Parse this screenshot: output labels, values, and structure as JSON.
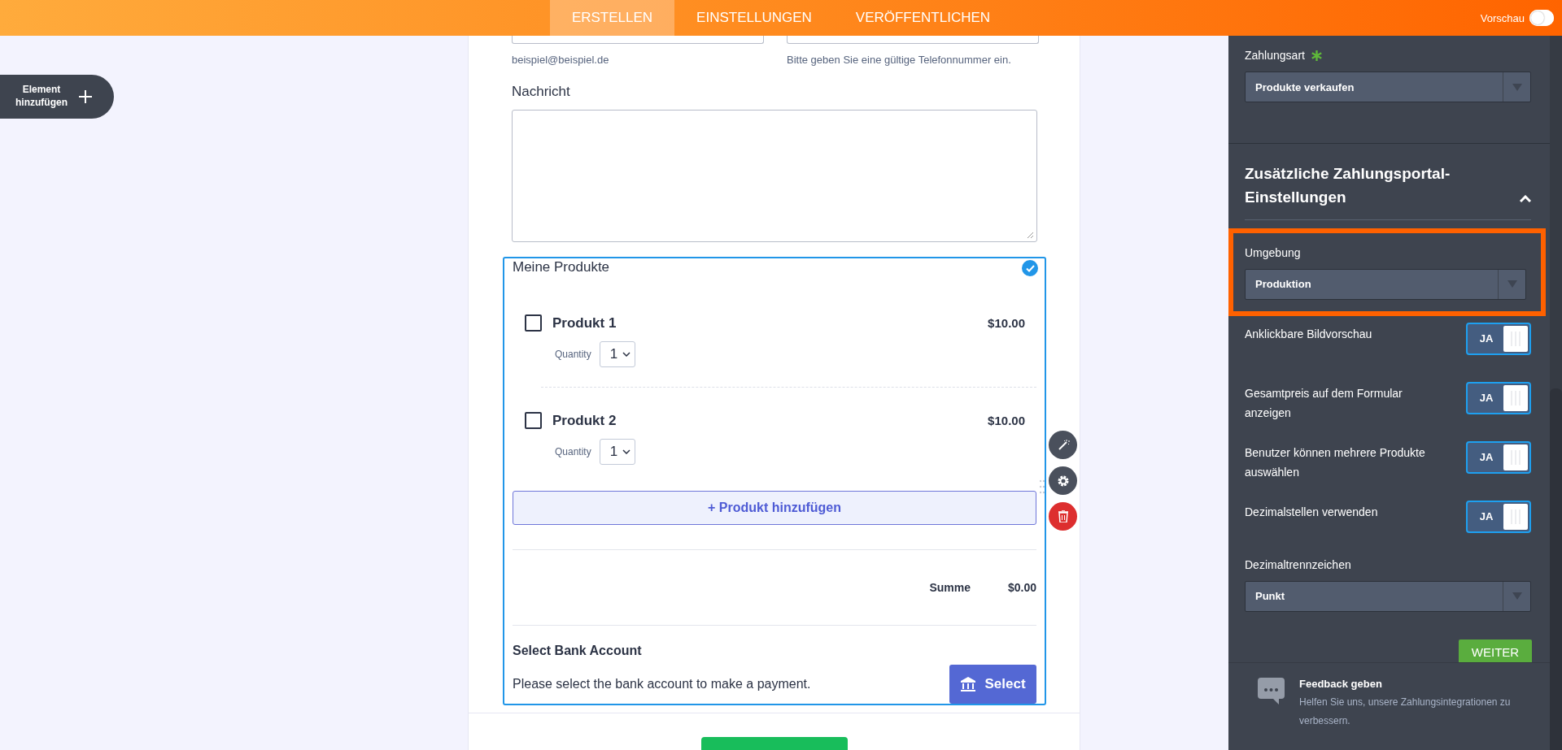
{
  "top_bar": {
    "tabs": [
      {
        "label": "ERSTELLEN",
        "selected": true
      },
      {
        "label": "EINSTELLUNGEN",
        "selected": false
      },
      {
        "label": "VERÖFFENTLICHEN",
        "selected": false
      }
    ],
    "preview": {
      "label": "Vorschau",
      "on": false
    }
  },
  "add_element": {
    "label": "Element hinzufügen"
  },
  "form": {
    "hints": [
      "beispiel@beispiel.de",
      "Bitte geben Sie eine gültige Telefonnummer ein."
    ],
    "message": {
      "label": "Nachricht"
    },
    "products": {
      "title": "Meine Produkte",
      "selected": true,
      "items": [
        {
          "name": "Produkt 1",
          "price": "$10.00",
          "checked": false,
          "quantity_label": "Quantity",
          "quantity": "1"
        },
        {
          "name": "Produkt 2",
          "price": "$10.00",
          "checked": false,
          "quantity_label": "Quantity",
          "quantity": "1"
        }
      ],
      "add_button": "+ Produkt hinzufügen",
      "total_label": "Summe",
      "total": "$0.00",
      "bank": {
        "title": "Select Bank Account",
        "text": "Please select the bank account to make a payment.",
        "button": "Select"
      }
    }
  },
  "settings": {
    "payment_type": {
      "label": "Zahlungsart",
      "required": true,
      "value": "Produkte verkaufen"
    },
    "section": {
      "title": "Zusätzliche Zahlungsportal-Einstellungen",
      "expanded": true
    },
    "fields": [
      {
        "kind": "select",
        "label": "Umgebung",
        "value": "Produktion",
        "highlighted": true
      },
      {
        "kind": "toggle",
        "label": "Anklickbare Bildvorschau",
        "on": true,
        "value": "JA"
      },
      {
        "kind": "toggle",
        "label": "Gesamtpreis auf dem Formular anzeigen",
        "on": true,
        "value": "JA"
      },
      {
        "kind": "toggle",
        "label": "Benutzer können mehrere Produkte auswählen",
        "on": true,
        "value": "JA"
      },
      {
        "kind": "toggle",
        "label": "Dezimalstellen verwenden",
        "on": true,
        "value": "JA"
      },
      {
        "kind": "select",
        "label": "Dezimaltrennzeichen",
        "value": "Punkt",
        "highlighted": false
      }
    ],
    "next_button": "WEITER",
    "feedback": {
      "title": "Feedback geben",
      "text": "Helfen Sie uns, unsere Zahlungsintegrationen zu verbessern."
    }
  }
}
